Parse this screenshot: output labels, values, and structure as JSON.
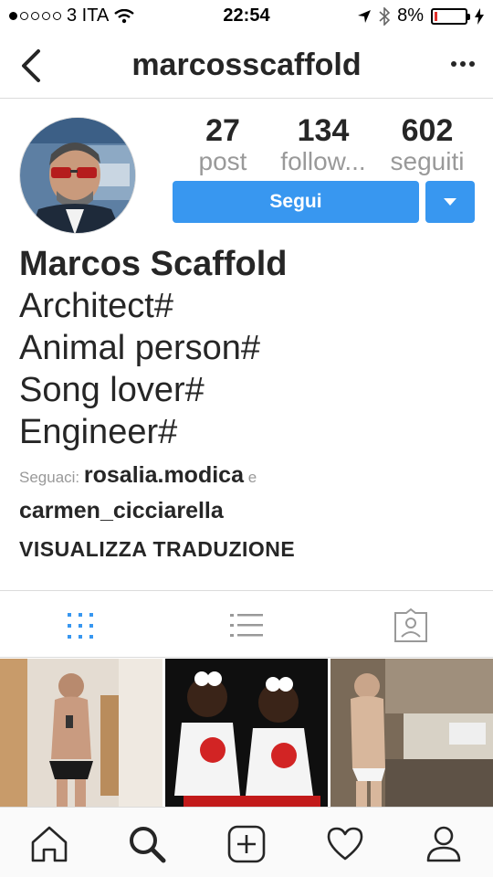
{
  "status_bar": {
    "carrier": "3 ITA",
    "time": "22:54",
    "battery": "8%",
    "battery_level": 0.08
  },
  "nav": {
    "title": "marcosscaffold"
  },
  "stats": [
    {
      "value": "27",
      "label": "post"
    },
    {
      "value": "134",
      "label": "follow..."
    },
    {
      "value": "602",
      "label": "seguiti"
    }
  ],
  "actions": {
    "follow_label": "Segui"
  },
  "profile": {
    "name": "Marcos Scaffold",
    "bio_lines": [
      "Architect#",
      "Animal person#",
      "Song lover#",
      "Engineer#"
    ],
    "followers_prefix": "Seguaci:",
    "follower_1": "rosalia.modica",
    "followers_and": "e",
    "follower_2": "carmen_cicciarella",
    "translate_label": "VISUALIZZA TRADUZIONE"
  },
  "tabs": [
    "grid-view",
    "list-view",
    "tagged-view"
  ],
  "colors": {
    "accent": "#3897f0",
    "text": "#262626",
    "muted": "#999999",
    "border": "#dbdbdb"
  },
  "bottom_nav": [
    "home-icon",
    "search-icon",
    "add-post-icon",
    "activity-heart-icon",
    "profile-icon"
  ]
}
